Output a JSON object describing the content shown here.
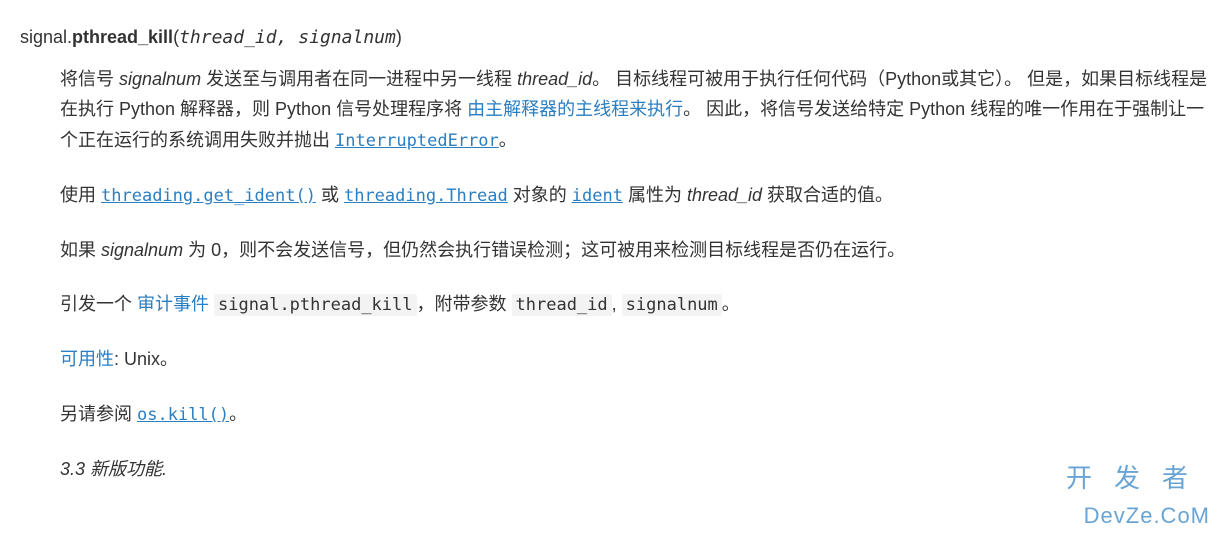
{
  "signature": {
    "module": "signal.",
    "name": "pthread_kill",
    "open": "(",
    "close": ")",
    "param1": "thread_id",
    "sep": ", ",
    "param2": "signalnum"
  },
  "para1": {
    "t1": "将信号 ",
    "em1": "signalnum",
    "t2": " 发送至与调用者在同一进程中另一线程 ",
    "em2": "thread_id",
    "t3": "。 目标线程可被用于执行任何代码（Python或其它）。 但是，如果目标线程是在执行 Python 解释器，则 Python 信号处理程序将 ",
    "link1": "由主解释器的主线程来执行",
    "t4": "。 因此，将信号发送给特定 Python 线程的唯一作用在于强制让一个正在运行的系统调用失败并抛出 ",
    "code1": "InterruptedError",
    "t5": "。"
  },
  "para2": {
    "t1": "使用 ",
    "code1": "threading.get_ident()",
    "t2": " 或 ",
    "code2": "threading.Thread",
    "t3": " 对象的 ",
    "code3": "ident",
    "t4": " 属性为 ",
    "em1": "thread_id",
    "t5": " 获取合适的值。"
  },
  "para3": {
    "t1": "如果 ",
    "em1": "signalnum",
    "t2": " 为 0，则不会发送信号，但仍然会执行错误检测；这可被用来检测目标线程是否仍在运行。"
  },
  "para4": {
    "t1": "引发一个 ",
    "link1": "审计事件",
    "t2": " ",
    "code1": "signal.pthread_kill",
    "t3": "，附带参数 ",
    "code2": "thread_id",
    "t4": ", ",
    "code3": "signalnum",
    "t5": "。"
  },
  "para5": {
    "link1": "可用性",
    "t1": ": Unix。"
  },
  "para6": {
    "t1": "另请参阅 ",
    "code1": "os.kill()",
    "t2": "。"
  },
  "versionadded": "3.3 新版功能.",
  "watermark": {
    "top": "开发者",
    "bottom": "DevZe.CoM"
  }
}
